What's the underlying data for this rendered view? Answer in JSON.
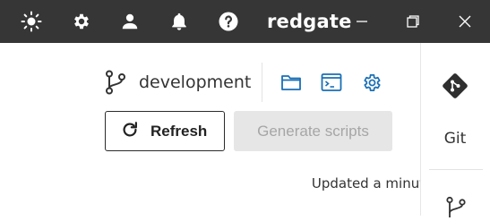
{
  "titlebar": {
    "brand": "redgate",
    "icons": [
      "theme-icon",
      "settings-icon",
      "account-icon",
      "notifications-icon",
      "help-icon"
    ],
    "window_controls": [
      "minimize-icon",
      "restore-icon",
      "close-icon"
    ],
    "background_color": "#363636",
    "foreground_color": "#ffffff"
  },
  "main": {
    "branch": {
      "icon": "branch-icon",
      "name": "development"
    },
    "actions": [
      {
        "name": "folder-icon",
        "color": "#1a6fb5"
      },
      {
        "name": "terminal-icon",
        "color": "#1a6fb5"
      },
      {
        "name": "repo-settings-icon",
        "color": "#1a6fb5"
      }
    ],
    "refresh_button": {
      "icon": "refresh-icon",
      "label": "Refresh"
    },
    "generate_button": {
      "label": "Generate scripts",
      "disabled": true
    },
    "status_text": "Updated a minute ago"
  },
  "sidebar": {
    "items": [
      {
        "icon": "git-icon",
        "label": "Git"
      },
      {
        "icon": "branch-icon",
        "label": ""
      }
    ]
  }
}
